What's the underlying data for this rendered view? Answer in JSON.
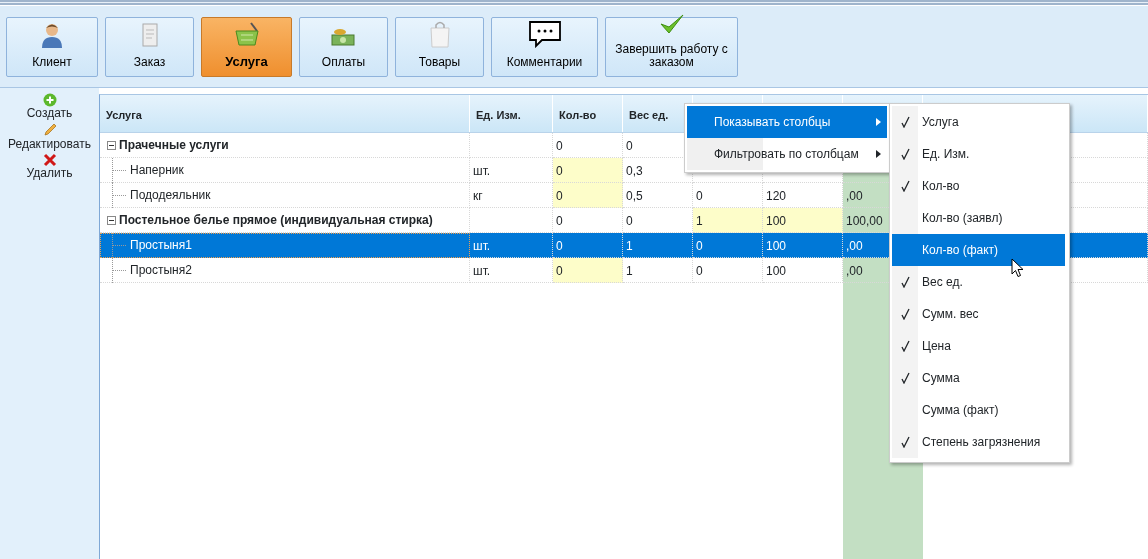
{
  "toolbar": {
    "buttons": [
      {
        "label": "Клиент",
        "selected": false
      },
      {
        "label": "Заказ",
        "selected": false
      },
      {
        "label": "Услуга",
        "selected": true
      },
      {
        "label": "Оплаты",
        "selected": false
      },
      {
        "label": "Товары",
        "selected": false
      },
      {
        "label": "Комментарии",
        "selected": false
      },
      {
        "label": "Завершить работу с заказом",
        "selected": false
      }
    ]
  },
  "sidebar": {
    "actions": [
      {
        "label": "Создать",
        "kind": "add"
      },
      {
        "label": "Редактировать",
        "kind": "edit"
      },
      {
        "label": "Удалить",
        "kind": "delete"
      }
    ]
  },
  "grid": {
    "columns": [
      {
        "label": "Услуга"
      },
      {
        "label": "Ед. Изм."
      },
      {
        "label": "Кол-во"
      },
      {
        "label": "Вес ед."
      },
      {},
      {},
      {
        "shaded": true
      }
    ],
    "rows": [
      {
        "name": "Прачечные услуги",
        "expanded": true,
        "selected": false,
        "cells": [
          {},
          {
            "text": "0",
            "highlighted": false
          },
          {
            "text": "0",
            "highlighted": false
          }
        ],
        "children": [
          {
            "name": "Наперник",
            "selected": false,
            "cells": [
              {
                "text": "шт.",
                "highlighted": false
              },
              {
                "text": "0",
                "highlighted": true
              },
              {
                "text": "0,3",
                "highlighted": false
              }
            ]
          },
          {
            "name": "Пододеяльник",
            "selected": false,
            "cells": [
              {
                "text": "кг",
                "highlighted": false
              },
              {
                "text": "0",
                "highlighted": true
              },
              {
                "text": "0,5",
                "highlighted": false
              },
              {
                "text": "0",
                "highlighted": false
              },
              {
                "text": "120",
                "highlighted": false
              },
              {
                "text": ",00",
                "highlighted": false
              }
            ]
          }
        ]
      },
      {
        "name": "Постельное белье прямое (индивидуальная стирка)",
        "expanded": true,
        "selected": false,
        "cells": [
          {},
          {
            "text": "0",
            "highlighted": false
          },
          {
            "text": "0",
            "highlighted": false
          },
          {
            "text": "1",
            "highlighted": true
          },
          {
            "text": "100",
            "highlighted": true
          },
          {
            "text": "100,00",
            "highlighted": false
          }
        ],
        "children": [
          {
            "name": "Простыня1",
            "selected": true,
            "cells": [
              {
                "text": "шт."
              },
              {
                "text": "0"
              },
              {
                "text": "1"
              },
              {
                "text": "0"
              },
              {
                "text": "100"
              },
              {
                "text": ",00"
              }
            ]
          },
          {
            "name": "Простыня2",
            "selected": false,
            "cells": [
              {
                "text": "шт.",
                "highlighted": false
              },
              {
                "text": "0",
                "highlighted": true
              },
              {
                "text": "1",
                "highlighted": false
              },
              {
                "text": "0",
                "highlighted": false
              },
              {
                "text": "100",
                "highlighted": false
              },
              {
                "text": ",00",
                "highlighted": false
              }
            ]
          }
        ]
      }
    ]
  },
  "context_menu": {
    "items": [
      {
        "label": "Показывать столбцы",
        "selected": true
      },
      {
        "label": "Фильтровать по столбцам",
        "selected": false
      }
    ],
    "submenu": {
      "items": [
        {
          "label": "Услуга",
          "checked": true,
          "selected": false
        },
        {
          "label": "Ед. Изм.",
          "checked": true,
          "selected": false
        },
        {
          "label": "Кол-во",
          "checked": true,
          "selected": false
        },
        {
          "label": "Кол-во (заявл)",
          "checked": false,
          "selected": false
        },
        {
          "label": "Кол-во (факт)",
          "checked": false,
          "selected": true
        },
        {
          "label": "Вес ед.",
          "checked": true,
          "selected": false
        },
        {
          "label": "Сумм. вес",
          "checked": true,
          "selected": false
        },
        {
          "label": "Цена",
          "checked": true,
          "selected": false
        },
        {
          "label": "Сумма",
          "checked": true,
          "selected": false
        },
        {
          "label": "Сумма (факт)",
          "checked": false,
          "selected": false
        },
        {
          "label": "Степень загрязнения",
          "checked": true,
          "selected": false
        }
      ]
    }
  }
}
